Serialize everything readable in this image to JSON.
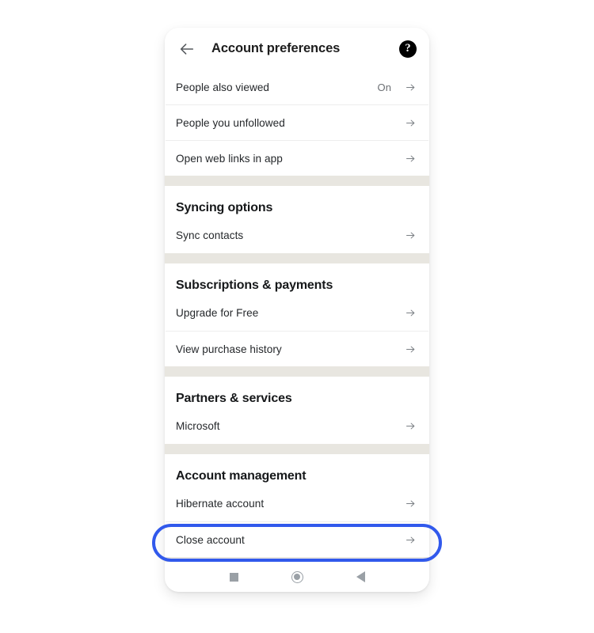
{
  "appbar": {
    "back_icon": "arrow-left-icon",
    "title": "Account preferences",
    "help_icon": "help-circle-icon"
  },
  "sections": [
    {
      "id": "general",
      "title": null,
      "rows": [
        {
          "label": "People also viewed",
          "value": "On",
          "arrow": "arrow-right-icon"
        },
        {
          "label": "People you unfollowed",
          "value": "",
          "arrow": "arrow-right-icon"
        },
        {
          "label": "Open web links in app",
          "value": "",
          "arrow": "arrow-right-icon"
        }
      ]
    },
    {
      "id": "syncing",
      "title": "Syncing options",
      "rows": [
        {
          "label": "Sync contacts",
          "value": "",
          "arrow": "arrow-right-icon"
        }
      ]
    },
    {
      "id": "subscriptions",
      "title": "Subscriptions & payments",
      "rows": [
        {
          "label": "Upgrade for Free",
          "value": "",
          "arrow": "arrow-right-icon"
        },
        {
          "label": "View purchase history",
          "value": "",
          "arrow": "arrow-right-icon"
        }
      ]
    },
    {
      "id": "partners",
      "title": "Partners & services",
      "rows": [
        {
          "label": "Microsoft",
          "value": "",
          "arrow": "arrow-right-icon"
        }
      ]
    },
    {
      "id": "account-management",
      "title": "Account management",
      "rows": [
        {
          "label": "Hibernate account",
          "value": "",
          "arrow": "arrow-right-icon"
        },
        {
          "label": "Close account",
          "value": "",
          "arrow": "arrow-right-icon"
        }
      ]
    }
  ],
  "navbar": {
    "recents_icon": "square-recents-icon",
    "home_icon": "circle-home-icon",
    "back_icon": "triangle-back-icon"
  },
  "annotation": {
    "target_label": "Close account",
    "color": "#3159EC"
  },
  "colors": {
    "page_background": "#FFFFFF",
    "card_background": "#FFFFFF",
    "section_band": "#E8E6E0",
    "divider": "#EDEDED",
    "text_primary": "#25282B",
    "text_secondary": "#6B6F73",
    "nav_icon": "#9AA0A6",
    "help_badge": "#000000",
    "highlight": "#3159EC"
  }
}
